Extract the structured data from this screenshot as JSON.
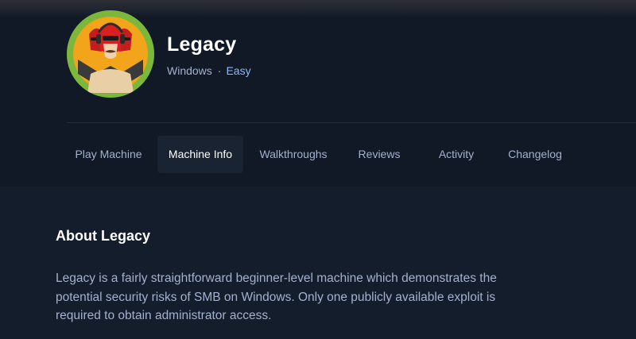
{
  "machine": {
    "name": "Legacy",
    "os": "Windows",
    "separator": "·",
    "difficulty": "Easy",
    "avatar_icon": "masked-hacker-avatar-icon"
  },
  "tabs": [
    {
      "label": "Play Machine",
      "active": false
    },
    {
      "label": "Machine Info",
      "active": true
    },
    {
      "label": "Walkthroughs",
      "active": false
    },
    {
      "label": "Reviews",
      "active": false
    },
    {
      "label": "Activity",
      "active": false
    },
    {
      "label": "Changelog",
      "active": false
    }
  ],
  "about": {
    "title": "About Legacy",
    "description": "Legacy is a fairly straightforward beginner-level machine which demonstrates the potential security risks of SMB on Windows. Only one publicly available exploit is required to obtain administrator access."
  },
  "colors": {
    "background": "#141d2b",
    "header_background": "#111927",
    "avatar_ring": "#7ab73b",
    "difficulty_easy": "#8fb8ff",
    "active_tab_background": "#1a2332"
  }
}
